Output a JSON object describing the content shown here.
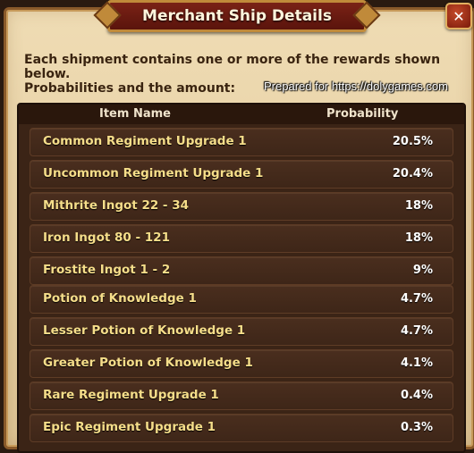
{
  "dialog": {
    "title": "Merchant Ship Details",
    "close_label": "✕",
    "description": "Each shipment contains one or more of the rewards shown below.",
    "subheading": "Probabilities and the amount:",
    "watermark": "Prepared for https://dolygames.com"
  },
  "table": {
    "headers": {
      "name": "Item Name",
      "probability": "Probability"
    },
    "rows": [
      {
        "name": "Common Regiment Upgrade 1",
        "probability": "20.5%"
      },
      {
        "name": "Uncommon Regiment Upgrade 1",
        "probability": "20.4%"
      },
      {
        "name": "Mithrite Ingot 22 - 34",
        "probability": "18%"
      },
      {
        "name": "Iron Ingot 80 - 121",
        "probability": "18%"
      },
      {
        "name": "Frostite Ingot 1 - 2",
        "probability": "9%"
      },
      {
        "name": "Potion of Knowledge 1",
        "probability": "4.7%"
      },
      {
        "name": "Lesser Potion of Knowledge 1",
        "probability": "4.7%"
      },
      {
        "name": "Greater Potion of Knowledge 1",
        "probability": "4.1%"
      },
      {
        "name": "Rare Regiment Upgrade 1",
        "probability": "0.4%"
      },
      {
        "name": "Epic Regiment Upgrade 1",
        "probability": "0.3%"
      }
    ]
  },
  "colors": {
    "banner": "#6a1a10",
    "item_text": "#f6de8a",
    "row_bg": "#4a2e1e",
    "parchment": "#e6cfa2"
  },
  "icons": {
    "close": "close-icon"
  }
}
